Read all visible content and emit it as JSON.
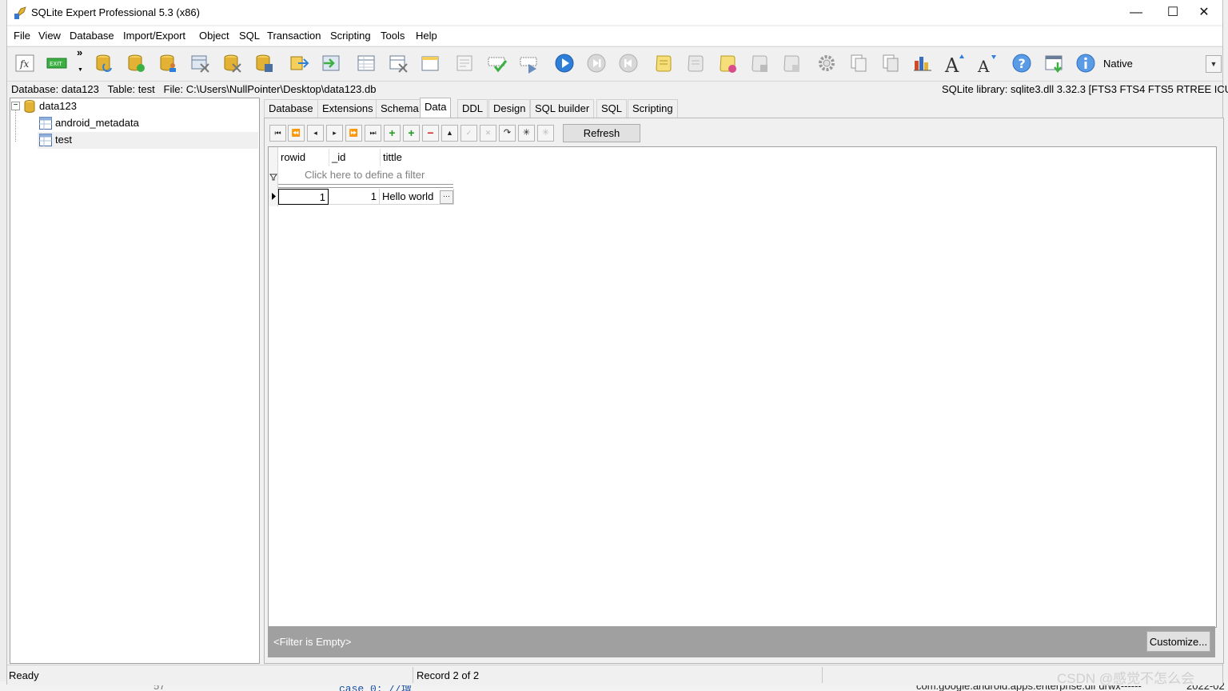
{
  "window": {
    "title": "SQLite Expert Professional 5.3 (x86)",
    "minimize_glyph": "—",
    "maximize_glyph": "☐",
    "close_glyph": "✕"
  },
  "menu": [
    "File",
    "View",
    "Database",
    "Import/Export",
    "Object",
    "SQL",
    "Transaction",
    "Scripting",
    "Tools",
    "Help"
  ],
  "toolbar": {
    "overflow_glyph": "»",
    "native_label": "Native",
    "icons": [
      "function-icon",
      "exit-icon",
      "open-database-icon",
      "new-database-icon",
      "attach-database-icon",
      "detach-database-icon",
      "table-icon",
      "remove-database-icon",
      "save-database-icon",
      "copy-database-icon",
      "import-icon",
      "new-table-icon",
      "delete-table-icon",
      "new-view-icon",
      "edit-icon",
      "commit-icon",
      "rollback-icon",
      "execute-icon",
      "execute-current-icon",
      "stop-icon",
      "script-icon",
      "script-run-icon",
      "script-save-icon",
      "script-open-icon",
      "script-new-icon",
      "settings-icon",
      "copy-icon",
      "paste-icon",
      "chart-icon",
      "font-increase-icon",
      "font-decrease-icon",
      "help-icon",
      "download-icon",
      "info-icon"
    ]
  },
  "info": {
    "left": "Database: data123   Table: test   File: C:\\Users\\NullPointer\\Desktop\\data123.db",
    "right": "SQLite library: sqlite3.dll 3.32.3 [FTS3 FTS4 FTS5 RTREE ICU]"
  },
  "tree": {
    "root": "data123",
    "children": [
      "android_metadata",
      "test"
    ],
    "expand_glyph": "−"
  },
  "tabs": [
    "Database",
    "Extensions",
    "Schema",
    "Data",
    "DDL",
    "Design",
    "SQL builder",
    "SQL",
    "Scripting"
  ],
  "active_tab": "Data",
  "nav_buttons": [
    "⏮",
    "⏪",
    "◂",
    "▸",
    "⏩",
    "⏭",
    "+",
    "+",
    "−",
    "▲",
    "✓",
    "✕",
    "↷",
    "✳",
    "✳"
  ],
  "refresh_label": "Refresh",
  "grid": {
    "columns": [
      "rowid",
      "_id",
      "tittle"
    ],
    "filter_hint": "Click here to define a filter",
    "rows": [
      {
        "rowid": "1",
        "id": "1",
        "tittle": "Hello world"
      }
    ],
    "ellipsis": "···"
  },
  "filter_bar": {
    "text": "<Filter is Empty>",
    "customize_label": "Customize..."
  },
  "status": {
    "ready": "Ready",
    "record": "Record 2 of 2"
  },
  "watermark": "CSDN @感觉不怎么会",
  "background_text": {
    "bottom_line_num": "57",
    "bottom_code": "case 0: //增",
    "bottom_file": "com.google.android.apps.enterprise.dif  drwx------",
    "bottom_date": "2022-02"
  },
  "colors": {
    "execute_blue": "#2f7fd8",
    "add_green": "#1f9a1f",
    "delete_red": "#d02020",
    "db_gold": "#e3b234"
  }
}
